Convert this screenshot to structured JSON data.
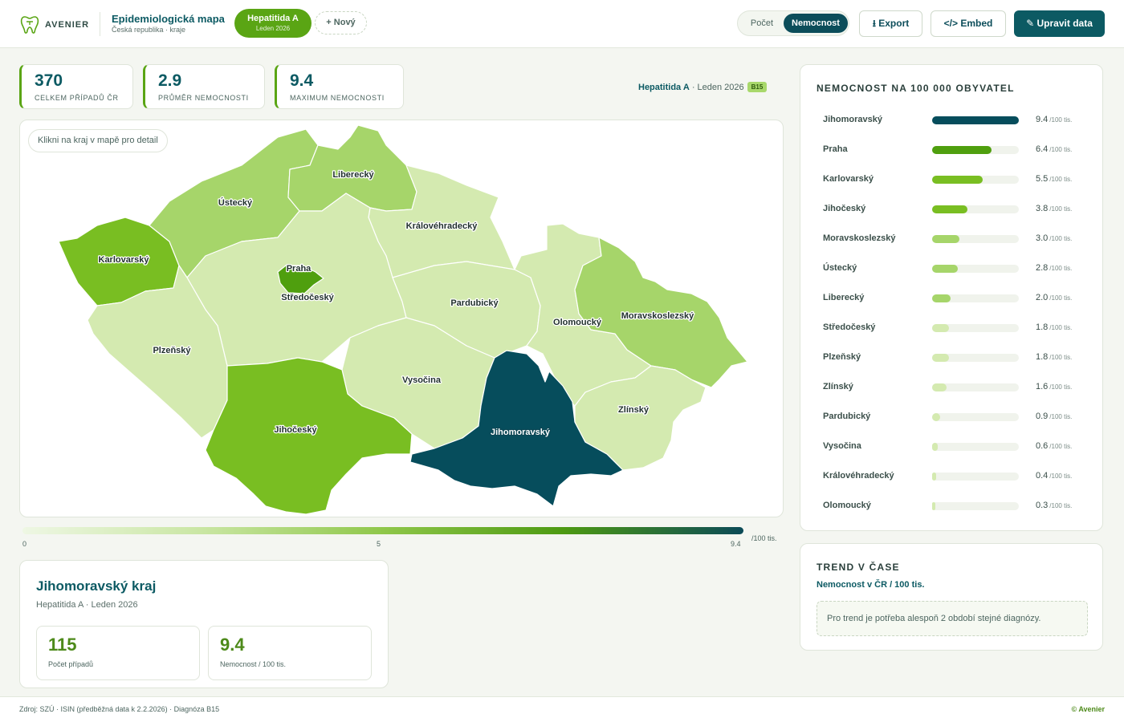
{
  "brand": {
    "name": "AVENIER",
    "logo_icon": "tooth-logo-icon"
  },
  "header": {
    "title": "Epidemiologická mapa",
    "subtitle": "Česká republika · kraje",
    "active_disease": {
      "name": "Hepatitida A",
      "period": "Leden 2026"
    },
    "new_label": "+ Nový",
    "toggle": {
      "option1": "Počet",
      "option2": "Nemocnost",
      "selected": "Nemocnost"
    },
    "export_label": "⭳ Export",
    "embed_label": "</> Embed",
    "edit_label": "✎ Upravit data"
  },
  "stats": [
    {
      "value": "370",
      "label": "CELKEM PŘÍPADŮ ČR"
    },
    {
      "value": "2.9",
      "label": "PRŮMĚR NEMOCNOSTI"
    },
    {
      "value": "9.4",
      "label": "MAXIMUM NEMOCNOSTI"
    }
  ],
  "selection": {
    "disease": "Hepatitida A",
    "sep_period": " · Leden 2026",
    "code": "B15"
  },
  "map": {
    "hint": "Klikni na kraj v mapě pro detail",
    "colors": {
      "c0": "#d4eab0",
      "c1": "#a6d56a",
      "c2": "#79be22",
      "c3": "#4f9f0e",
      "c4": "#064d5c"
    },
    "regions": [
      {
        "name": "Karlovarský",
        "rate": 5.5,
        "color_key": "c2"
      },
      {
        "name": "Ústecký",
        "rate": 2.8,
        "color_key": "c1"
      },
      {
        "name": "Liberecký",
        "rate": 2.0,
        "color_key": "c1"
      },
      {
        "name": "Královéhradecký",
        "rate": 0.4,
        "color_key": "c0"
      },
      {
        "name": "Praha",
        "rate": 6.4,
        "color_key": "c3"
      },
      {
        "name": "Středočeský",
        "rate": 1.8,
        "color_key": "c0"
      },
      {
        "name": "Plzeňský",
        "rate": 1.8,
        "color_key": "c0"
      },
      {
        "name": "Pardubický",
        "rate": 0.9,
        "color_key": "c0"
      },
      {
        "name": "Olomoucký",
        "rate": 0.3,
        "color_key": "c0"
      },
      {
        "name": "Moravskoslezský",
        "rate": 3.0,
        "color_key": "c1"
      },
      {
        "name": "Vysočina",
        "rate": 0.6,
        "color_key": "c0"
      },
      {
        "name": "Jihočeský",
        "rate": 3.8,
        "color_key": "c2"
      },
      {
        "name": "Jihomoravský",
        "rate": 9.4,
        "color_key": "c4"
      },
      {
        "name": "Zlínský",
        "rate": 1.6,
        "color_key": "c0"
      }
    ]
  },
  "legend": {
    "min": "0",
    "mid": "5",
    "max": "9.4",
    "unit": "/100 tis."
  },
  "detail": {
    "title": "Jihomoravský kraj",
    "subtitle": "Hepatitida A · Leden 2026",
    "cases_value": "115",
    "cases_label": "Počet případů",
    "rate_value": "9.4",
    "rate_label": "Nemocnost / 100 tis."
  },
  "ranking": {
    "title": "NEMOCNOST NA 100 000 OBYVATEL",
    "unit": "/100 tis.",
    "max": 9.4,
    "rows": [
      {
        "name": "Jihomoravský",
        "value": "9.4",
        "rate": 9.4,
        "color": "#064d5c"
      },
      {
        "name": "Praha",
        "value": "6.4",
        "rate": 6.4,
        "color": "#4f9f0e"
      },
      {
        "name": "Karlovarský",
        "value": "5.5",
        "rate": 5.5,
        "color": "#79be22"
      },
      {
        "name": "Jihočeský",
        "value": "3.8",
        "rate": 3.8,
        "color": "#79be22"
      },
      {
        "name": "Moravskoslezský",
        "value": "3.0",
        "rate": 3.0,
        "color": "#a6d56a"
      },
      {
        "name": "Ústecký",
        "value": "2.8",
        "rate": 2.8,
        "color": "#a6d56a"
      },
      {
        "name": "Liberecký",
        "value": "2.0",
        "rate": 2.0,
        "color": "#a6d56a"
      },
      {
        "name": "Středočeský",
        "value": "1.8",
        "rate": 1.8,
        "color": "#d4eab0"
      },
      {
        "name": "Plzeňský",
        "value": "1.8",
        "rate": 1.8,
        "color": "#d4eab0"
      },
      {
        "name": "Zlínský",
        "value": "1.6",
        "rate": 1.6,
        "color": "#d4eab0"
      },
      {
        "name": "Pardubický",
        "value": "0.9",
        "rate": 0.9,
        "color": "#d4eab0"
      },
      {
        "name": "Vysočina",
        "value": "0.6",
        "rate": 0.6,
        "color": "#d4eab0"
      },
      {
        "name": "Královéhradecký",
        "value": "0.4",
        "rate": 0.4,
        "color": "#d4eab0"
      },
      {
        "name": "Olomoucký",
        "value": "0.3",
        "rate": 0.3,
        "color": "#d4eab0"
      }
    ]
  },
  "trend": {
    "title": "TREND V ČASE",
    "subtitle": "Nemocnost v ČR / 100 tis.",
    "note": "Pro trend je potřeba alespoň 2 období stejné diagnózy."
  },
  "footer": {
    "source": "Zdroj: SZÚ · ISIN (předběžná data k 2.2.2026)  · Diagnóza B15",
    "brand": "© Avenier"
  }
}
